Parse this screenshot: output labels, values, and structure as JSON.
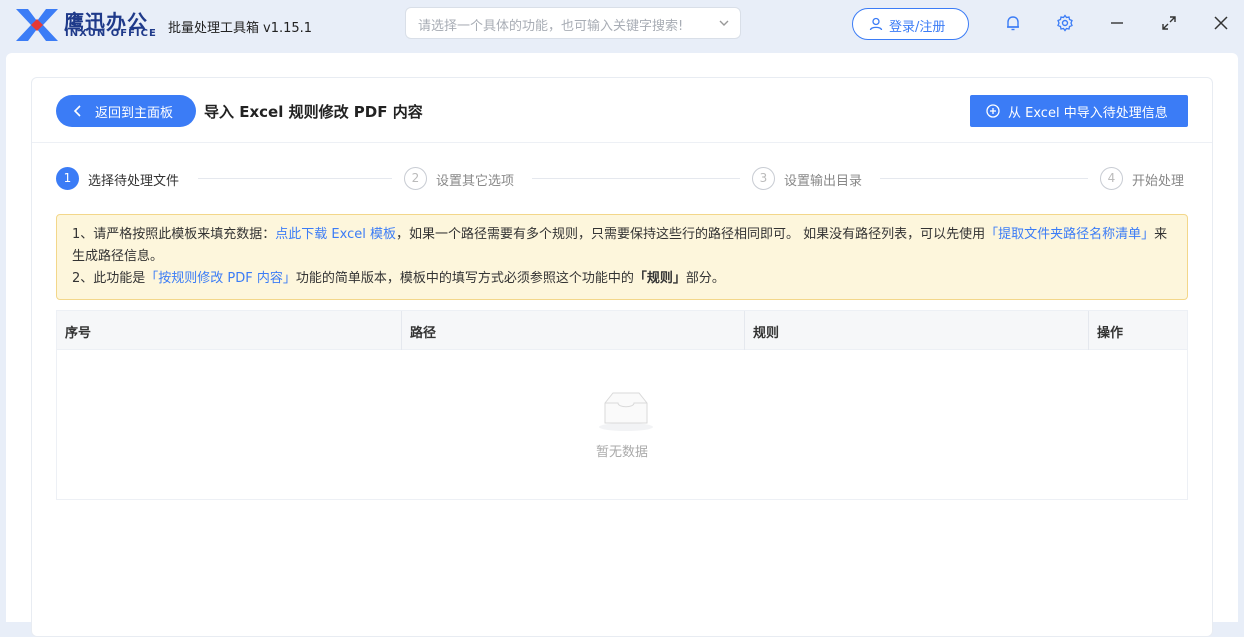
{
  "brand": {
    "name_cn": "鹰迅办公",
    "name_en": "INXUN OFFICE"
  },
  "app": {
    "title": "批量处理工具箱",
    "version": "v1.15.1"
  },
  "search": {
    "placeholder": "请选择一个具体的功能，也可输入关键字搜索!"
  },
  "header": {
    "login_label": "登录/注册"
  },
  "page": {
    "back_label": "返回到主面板",
    "title": "导入 Excel 规则修改 PDF 内容",
    "import_label": "从 Excel 中导入待处理信息"
  },
  "steps": [
    {
      "num": "1",
      "label": "选择待处理文件"
    },
    {
      "num": "2",
      "label": "设置其它选项"
    },
    {
      "num": "3",
      "label": "设置输出目录"
    },
    {
      "num": "4",
      "label": "开始处理"
    }
  ],
  "notice": {
    "l1_a": "1、请严格按照此模板来填充数据：",
    "l1_link": "点此下载 Excel 模板",
    "l1_b": "，如果一个路径需要有多个规则，只需要保持这些行的路径相同即可。 如果没有路径列表，可以先使用",
    "l1_link2": "「提取文件夹路径名称清单」",
    "l1_c": "来生成路径信息。",
    "l2_a": "2、此功能是",
    "l2_link": "「按规则修改 PDF 内容」",
    "l2_b": "功能的简单版本，模板中的填写方式必须参照这个功能中的",
    "l2_bold": "「规则」",
    "l2_c": "部分。"
  },
  "table": {
    "columns": [
      "序号",
      "路径",
      "规则",
      "操作"
    ],
    "empty_text": "暂无数据"
  },
  "colors": {
    "accent": "#3b7cf6",
    "notice_bg": "#fdf6dc",
    "notice_border": "#f3d78a"
  }
}
